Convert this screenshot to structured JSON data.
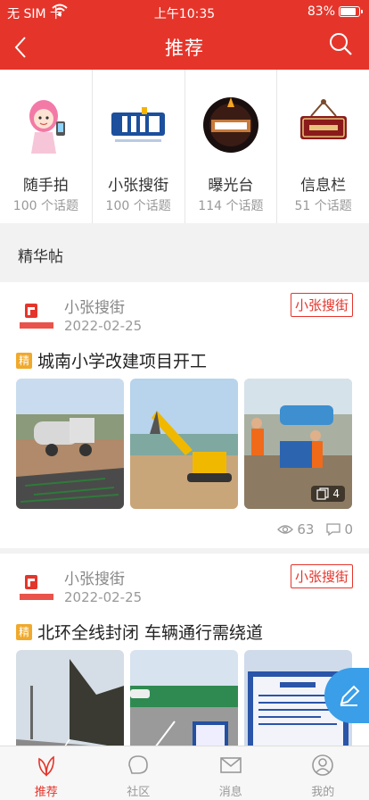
{
  "status_bar": {
    "carrier": "无 SIM 卡",
    "time": "上午10:35",
    "battery": "83%"
  },
  "nav": {
    "title": "推荐",
    "back_icon": "chevron-left-icon",
    "search_icon": "search-icon"
  },
  "topics": [
    {
      "name": "随手拍",
      "count": "100 个话题"
    },
    {
      "name": "小张搜街",
      "count": "100 个话题"
    },
    {
      "name": "曝光台",
      "count": "114 个话题"
    },
    {
      "name": "信息栏",
      "count": "51 个话题"
    }
  ],
  "section": {
    "title": "精华帖"
  },
  "posts": [
    {
      "author": "小张搜街",
      "date": "2022-02-25",
      "tag": "小张搜街",
      "badge": "精",
      "title": "城南小学改建项目开工",
      "photo_count": "4",
      "views": "63",
      "comments": "0"
    },
    {
      "author": "小张搜街",
      "date": "2022-02-25",
      "tag": "小张搜街",
      "badge": "精",
      "title": "北环全线封闭 车辆通行需绕道"
    }
  ],
  "tabs": [
    {
      "label": "推荐",
      "icon": "leaf-icon",
      "active": true
    },
    {
      "label": "社区",
      "icon": "community-icon"
    },
    {
      "label": "消息",
      "icon": "mail-icon"
    },
    {
      "label": "我的",
      "icon": "user-icon"
    }
  ],
  "colors": {
    "brand": "#e5352b",
    "badge": "#f0a92b",
    "fab": "#3a9ee8"
  }
}
